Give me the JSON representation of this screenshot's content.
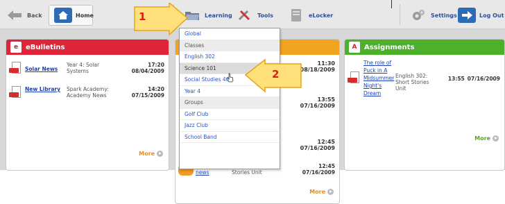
{
  "toolbar": {
    "back_label": "Back",
    "home_label": "Home",
    "learning_label": "Learning",
    "tools_label": "Tools",
    "elocker_label": "eLocker",
    "settings_label": "Settings",
    "logout_label": "Log Out"
  },
  "dropdown": {
    "items": [
      {
        "label": "Global",
        "kind": "item"
      },
      {
        "label": "Classes",
        "kind": "header"
      },
      {
        "label": "English 302",
        "kind": "item"
      },
      {
        "label": "Science 101",
        "kind": "hover"
      },
      {
        "label": "Social Studies 404",
        "kind": "item"
      },
      {
        "label": "Year 4",
        "kind": "item"
      },
      {
        "label": "Groups",
        "kind": "header"
      },
      {
        "label": "Golf Club",
        "kind": "item"
      },
      {
        "label": "Jazz Club",
        "kind": "item"
      },
      {
        "label": "School Band",
        "kind": "item"
      }
    ]
  },
  "callouts": {
    "one": "1",
    "two": "2"
  },
  "ebulletins": {
    "title": "eBulletins",
    "rows": [
      {
        "link": "Solar News",
        "desc": "Year 4: Solar Systems",
        "time": "17:20",
        "date": "08/04/2009"
      },
      {
        "link": "New Library",
        "desc": "Spark Academy: Academy News",
        "time": "14:20",
        "date": "07/15/2009"
      }
    ],
    "more": "More"
  },
  "middle": {
    "rows": [
      {
        "time": "11:30",
        "date": "08/18/2009"
      },
      {
        "time": "13:55",
        "date": "07/16/2009"
      },
      {
        "time": "12:45",
        "date": "07/16/2009"
      }
    ],
    "last_row": {
      "link": "Literature news",
      "desc": "English 302: Short Stories Unit",
      "time": "12:45",
      "date": "07/16/2009"
    },
    "more": "More"
  },
  "assignments": {
    "title": "Assignments",
    "row": {
      "link": "The role of Puck in A Midsummer Night's Dream",
      "desc": "English 302: Short Stories Unit",
      "time": "13:55",
      "date": "07/16/2009"
    },
    "more": "More"
  },
  "colors": {
    "ebulletins": "#e0253a",
    "middle": "#f0a422",
    "assignments": "#4cb02a",
    "callout_fill": "#ffe07a",
    "callout_border": "#e9a21a"
  }
}
